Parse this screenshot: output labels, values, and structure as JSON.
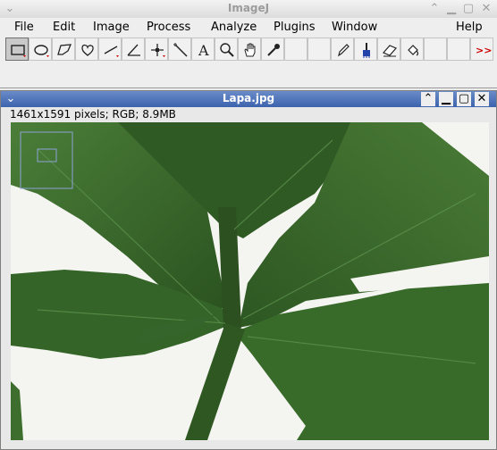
{
  "app": {
    "title": "ImageJ",
    "titlebar_buttons": [
      "chevron-down-icon",
      "chevron-up-icon",
      "minimize-icon",
      "maximize-icon",
      "close-icon"
    ]
  },
  "menu": [
    "File",
    "Edit",
    "Image",
    "Process",
    "Analyze",
    "Plugins",
    "Window",
    "Help"
  ],
  "toolbar": {
    "tools": [
      {
        "name": "rectangle-selection-icon",
        "selected": true
      },
      {
        "name": "oval-selection-icon"
      },
      {
        "name": "polygon-selection-icon"
      },
      {
        "name": "freehand-selection-icon"
      },
      {
        "name": "line-selection-icon"
      },
      {
        "name": "angle-tool-icon"
      },
      {
        "name": "point-tool-icon"
      },
      {
        "name": "wand-tool-icon"
      },
      {
        "name": "text-tool-icon"
      },
      {
        "name": "magnifying-glass-icon"
      },
      {
        "name": "scrolling-hand-icon"
      },
      {
        "name": "color-picker-icon"
      },
      {
        "name": "empty-slot"
      },
      {
        "name": "empty-slot"
      },
      {
        "name": "pencil-icon"
      },
      {
        "name": "paintbrush-icon"
      },
      {
        "name": "eraser-icon"
      },
      {
        "name": "flood-fill-icon"
      },
      {
        "name": "empty-slot"
      },
      {
        "name": "empty-slot"
      },
      {
        "name": "more-tools-icon"
      }
    ],
    "text_tool_glyph": "A",
    "more_tools_glyph": ">>"
  },
  "image_window": {
    "title": "Lapa.jpg",
    "info": "1461x1591 pixels; RGB; 8.9MB",
    "titlebar_buttons": [
      "chevron-up-icon",
      "minimize-icon",
      "maximize-icon",
      "close-icon"
    ]
  },
  "colors": {
    "image_titlebar": "#3c63ad",
    "leaf_dark": "#2f5a23",
    "leaf_mid": "#3f7030",
    "background_paper": "#f4f4f0"
  }
}
